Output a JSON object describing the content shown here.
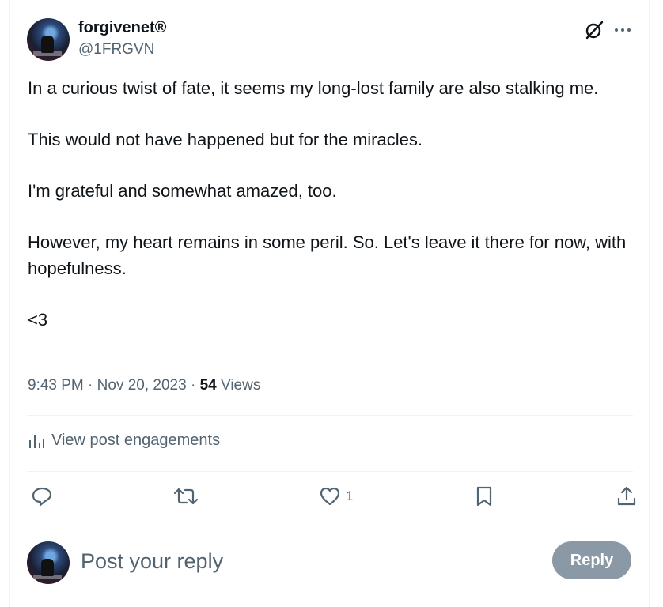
{
  "author": {
    "name": "forgivenet®",
    "handle": "@1FRGVN"
  },
  "post": {
    "paragraphs": [
      "In a curious twist of fate, it seems my long-lost family are also stalking me.",
      "This would not have happened but for the miracles.",
      "I'm grateful and somewhat amazed, too.",
      "However, my heart remains in some peril. So. Let's leave it there for now, with hopefulness.",
      "<3"
    ],
    "time": "9:43 PM",
    "date": "Nov 20, 2023",
    "separator": "·",
    "views_count": "54",
    "views_label": "Views"
  },
  "engagements": {
    "label": "View post engagements",
    "icon": "analytics-icon"
  },
  "actions": {
    "reply_icon": "reply-icon",
    "repost_icon": "repost-icon",
    "like_icon": "heart-icon",
    "like_count": "1",
    "bookmark_icon": "bookmark-icon",
    "share_icon": "share-icon"
  },
  "composer": {
    "placeholder": "Post your reply",
    "button_label": "Reply"
  },
  "colors": {
    "text_primary": "#0f1419",
    "text_secondary": "#536471",
    "divider": "#eff3f4",
    "reply_button_disabled": "#8b98a5"
  }
}
